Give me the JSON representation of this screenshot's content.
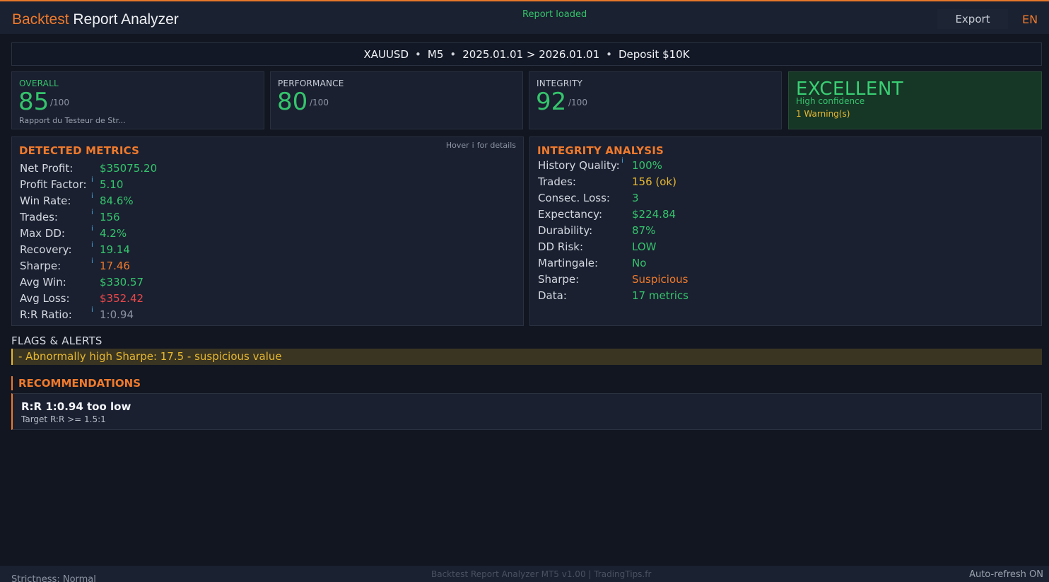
{
  "header": {
    "title_accent": "Backtest",
    "title_rest": " Report Analyzer",
    "status": "Report loaded",
    "export_label": "Export",
    "lang_label": "EN"
  },
  "infobar": {
    "symbol": "XAUUSD",
    "timeframe": "M5",
    "period": "2025.01.01 > 2026.01.01",
    "deposit": "Deposit $10K",
    "separator": "•"
  },
  "scores": {
    "overall": {
      "label": "OVERALL",
      "value": "85",
      "max": "/100",
      "sub": "Rapport du Testeur de Str..."
    },
    "performance": {
      "label": "PERFORMANCE",
      "value": "80",
      "max": "/100"
    },
    "integrity": {
      "label": "INTEGRITY",
      "value": "92",
      "max": "/100"
    }
  },
  "verdict": {
    "title": "EXCELLENT",
    "confidence": "High confidence",
    "warnings": "1 Warning(s)",
    "accent_color": "#3ad074"
  },
  "metrics": {
    "title": "DETECTED METRICS",
    "hint_prefix": "Hover",
    "hint_icon": "i",
    "hint_suffix": "for details",
    "info_glyph": "i",
    "rows": [
      {
        "key": "Net Profit:",
        "value": "$35075.20",
        "color": "green",
        "info": false
      },
      {
        "key": "Profit Factor:",
        "value": "5.10",
        "color": "green",
        "info": true
      },
      {
        "key": "Win Rate:",
        "value": "84.6%",
        "color": "green",
        "info": true
      },
      {
        "key": "Trades:",
        "value": "156",
        "color": "green",
        "info": true
      },
      {
        "key": "Max DD:",
        "value": "4.2%",
        "color": "green",
        "info": true
      },
      {
        "key": "Recovery:",
        "value": "19.14",
        "color": "green",
        "info": true
      },
      {
        "key": "Sharpe:",
        "value": "17.46",
        "color": "orange",
        "info": true
      },
      {
        "key": "Avg Win:",
        "value": "$330.57",
        "color": "green",
        "info": false
      },
      {
        "key": "Avg Loss:",
        "value": "$352.42",
        "color": "red",
        "info": false
      },
      {
        "key": "R:R Ratio:",
        "value": "1:0.94",
        "color": "gray",
        "info": true
      }
    ]
  },
  "integrity_analysis": {
    "title": "INTEGRITY ANALYSIS",
    "info_glyph": "i",
    "rows": [
      {
        "key": "History Quality:",
        "value": "100%",
        "color": "green",
        "info": true
      },
      {
        "key": "Trades:",
        "value": "156 (ok)",
        "color": "yellow",
        "info": false
      },
      {
        "key": "Consec. Loss:",
        "value": "3",
        "color": "green",
        "info": false
      },
      {
        "key": "Expectancy:",
        "value": "$224.84",
        "color": "green",
        "info": false
      },
      {
        "key": "Durability:",
        "value": "87%",
        "color": "green",
        "info": false
      },
      {
        "key": "DD Risk:",
        "value": "LOW",
        "color": "green",
        "info": false
      },
      {
        "key": "Martingale:",
        "value": "No",
        "color": "green",
        "info": false
      },
      {
        "key": "Sharpe:",
        "value": "Suspicious",
        "color": "orange",
        "info": false
      },
      {
        "key": "Data:",
        "value": "17 metrics",
        "color": "green",
        "info": false
      }
    ]
  },
  "flags": {
    "title": "FLAGS & ALERTS",
    "items": [
      "- Abnormally high Sharpe: 17.5 - suspicious value"
    ]
  },
  "recommendations": {
    "title": "RECOMMENDATIONS",
    "items": [
      {
        "head": "R:R 1:0.94 too low",
        "desc": "Target R:R >= 1.5:1"
      }
    ]
  },
  "footer": {
    "strictness": "Strictness: Normal",
    "version": "Backtest Report Analyzer MT5 v1.00 | TradingTips.fr",
    "autorefresh": "Auto-refresh ON"
  }
}
